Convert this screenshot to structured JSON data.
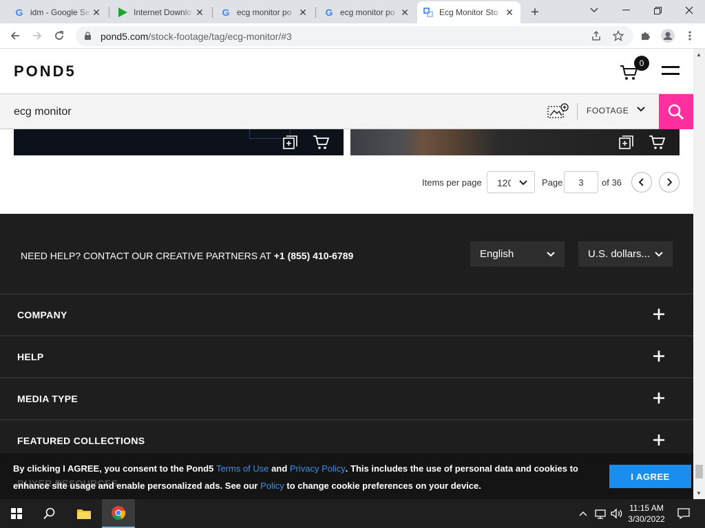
{
  "browser": {
    "tabs": [
      {
        "title": "idm - Google Se",
        "icon": "google-icon"
      },
      {
        "title": "Internet Downlo",
        "icon": "idm-play-icon"
      },
      {
        "title": "ecg monitor po",
        "icon": "google-icon"
      },
      {
        "title": "ecg monitor po",
        "icon": "google-icon"
      },
      {
        "title": "Ecg Monitor Sto",
        "icon": "pond5-icon",
        "active": true
      }
    ],
    "url_host": "pond5.com",
    "url_path": "/stock-footage/tag/ecg-monitor/#3"
  },
  "header": {
    "logo": "POND5",
    "cart_count": "0"
  },
  "search": {
    "query": "ecg monitor",
    "media_type": "FOOTAGE"
  },
  "pager": {
    "items_per_page_label": "Items per page",
    "items_per_page_value": "120",
    "page_label": "Page",
    "page_value": "3",
    "of_label": "of 36"
  },
  "footer": {
    "help_text": "NEED HELP? CONTACT OUR CREATIVE PARTNERS AT ",
    "help_phone": "+1 (855) 410-6789",
    "language": "English",
    "currency": "U.S. dollars...",
    "sections": [
      "COMPANY",
      "HELP",
      "MEDIA TYPE",
      "FEATURED COLLECTIONS"
    ],
    "partial_section": "BUYER RESOURCES"
  },
  "cookie": {
    "t1": "By clicking I AGREE, you consent to the Pond5 ",
    "terms": "Terms of Use",
    "t2": " and ",
    "privacy": "Privacy Policy",
    "t3": ". This includes the use of personal data and cookies to enhance site usage and enable personalized ads. See our ",
    "policy": "Policy",
    "t4": " to change cookie preferences on your device.",
    "agree": "I AGREE"
  },
  "taskbar": {
    "time": "11:15 AM",
    "date": "3/30/2022"
  },
  "colors": {
    "accent_pink": "#ff2fa0",
    "agree_blue": "#1a8df0",
    "footer_bg": "#1e1e1e"
  }
}
